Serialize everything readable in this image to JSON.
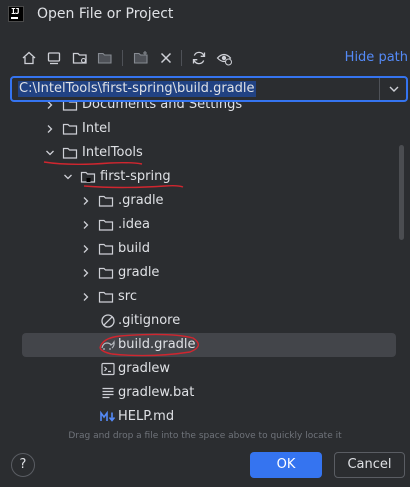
{
  "window": {
    "title": "Open File or Project"
  },
  "toolbar": {
    "hide_path_label": "Hide path"
  },
  "path_field": {
    "value": "C:\\IntelTools\\first-spring\\build.gradle"
  },
  "tree": {
    "rows": [
      {
        "label": "Documents and Settings"
      },
      {
        "label": "Intel"
      },
      {
        "label": "IntelTools"
      },
      {
        "label": "first-spring"
      },
      {
        "label": ".gradle"
      },
      {
        "label": ".idea"
      },
      {
        "label": "build"
      },
      {
        "label": "gradle"
      },
      {
        "label": "src"
      },
      {
        "label": ".gitignore"
      },
      {
        "label": "build.gradle"
      },
      {
        "label": "gradlew"
      },
      {
        "label": "gradlew.bat"
      },
      {
        "label": "HELP.md"
      }
    ]
  },
  "hint": "Drag and drop a file into the space above to quickly locate it",
  "footer": {
    "help_label": "?",
    "ok_label": "OK",
    "cancel_label": "Cancel"
  },
  "colors": {
    "accent": "#3574f0",
    "link": "#548af7",
    "annotation": "#d0262f",
    "background": "#2b2d30"
  }
}
